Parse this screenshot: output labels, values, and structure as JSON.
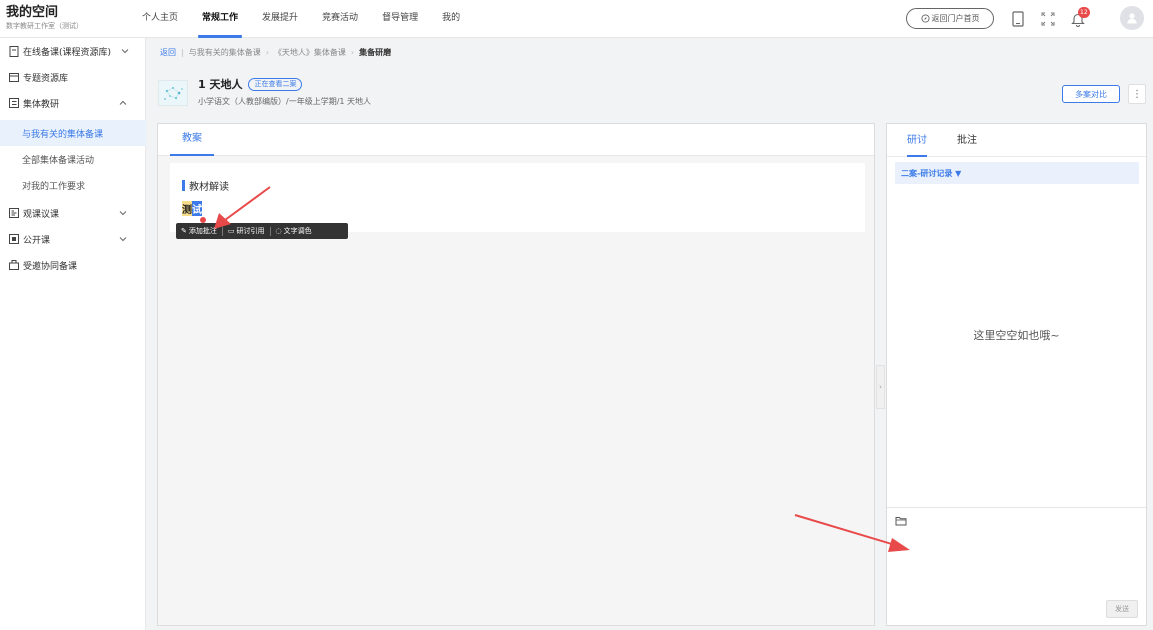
{
  "app": {
    "title": "我的空间",
    "subtitle": "数字教研工作室（测试）"
  },
  "nav": {
    "items": [
      {
        "label": "个人主页"
      },
      {
        "label": "常规工作"
      },
      {
        "label": "发展提升"
      },
      {
        "label": "竞赛活动"
      },
      {
        "label": "督导管理"
      },
      {
        "label": "我的"
      }
    ],
    "active_index": 1,
    "portal_label": "返回门户首页",
    "notification_count": "12"
  },
  "sidebar": {
    "items": [
      {
        "label": "在线备课(课程资源库)",
        "icon": "document-icon"
      },
      {
        "label": "专题资源库",
        "icon": "folder-icon"
      },
      {
        "label": "集体教研",
        "icon": "list-icon"
      },
      {
        "label": "与我有关的集体备课"
      },
      {
        "label": "全部集体备课活动"
      },
      {
        "label": "对我的工作要求"
      },
      {
        "label": "观课议课",
        "icon": "observe-icon"
      },
      {
        "label": "公开课",
        "icon": "play-icon"
      },
      {
        "label": "受邀协同备课",
        "icon": "group-icon"
      }
    ]
  },
  "breadcrumb": {
    "back": "返回",
    "items": [
      "与我有关的集体备课",
      "《天地人》集体备课",
      "集备研磨"
    ]
  },
  "lesson": {
    "title": "1 天地人",
    "tag": "正在查看二案",
    "subtitle": "小学语文（人教部编版）/一年级上学期/1 天地人",
    "compare_label": "多案对比",
    "more_label": "⋮"
  },
  "main": {
    "tab_label": "教案",
    "section_heading": "教材解读",
    "text_part1": "测",
    "text_part2": "试",
    "toolbar": {
      "add_annotation": "添加批注",
      "quote": "研讨引用",
      "text_color": "文字调色"
    }
  },
  "right": {
    "tabs": [
      "研讨",
      "批注"
    ],
    "record_label": "二案-研讨记录 ▼",
    "empty_text": "这里空空如也哦~",
    "send_label": "发送"
  },
  "colors": {
    "accent": "#3b7ae8",
    "arrow": "#e84a4a",
    "highlight": "#f6dd8b"
  }
}
